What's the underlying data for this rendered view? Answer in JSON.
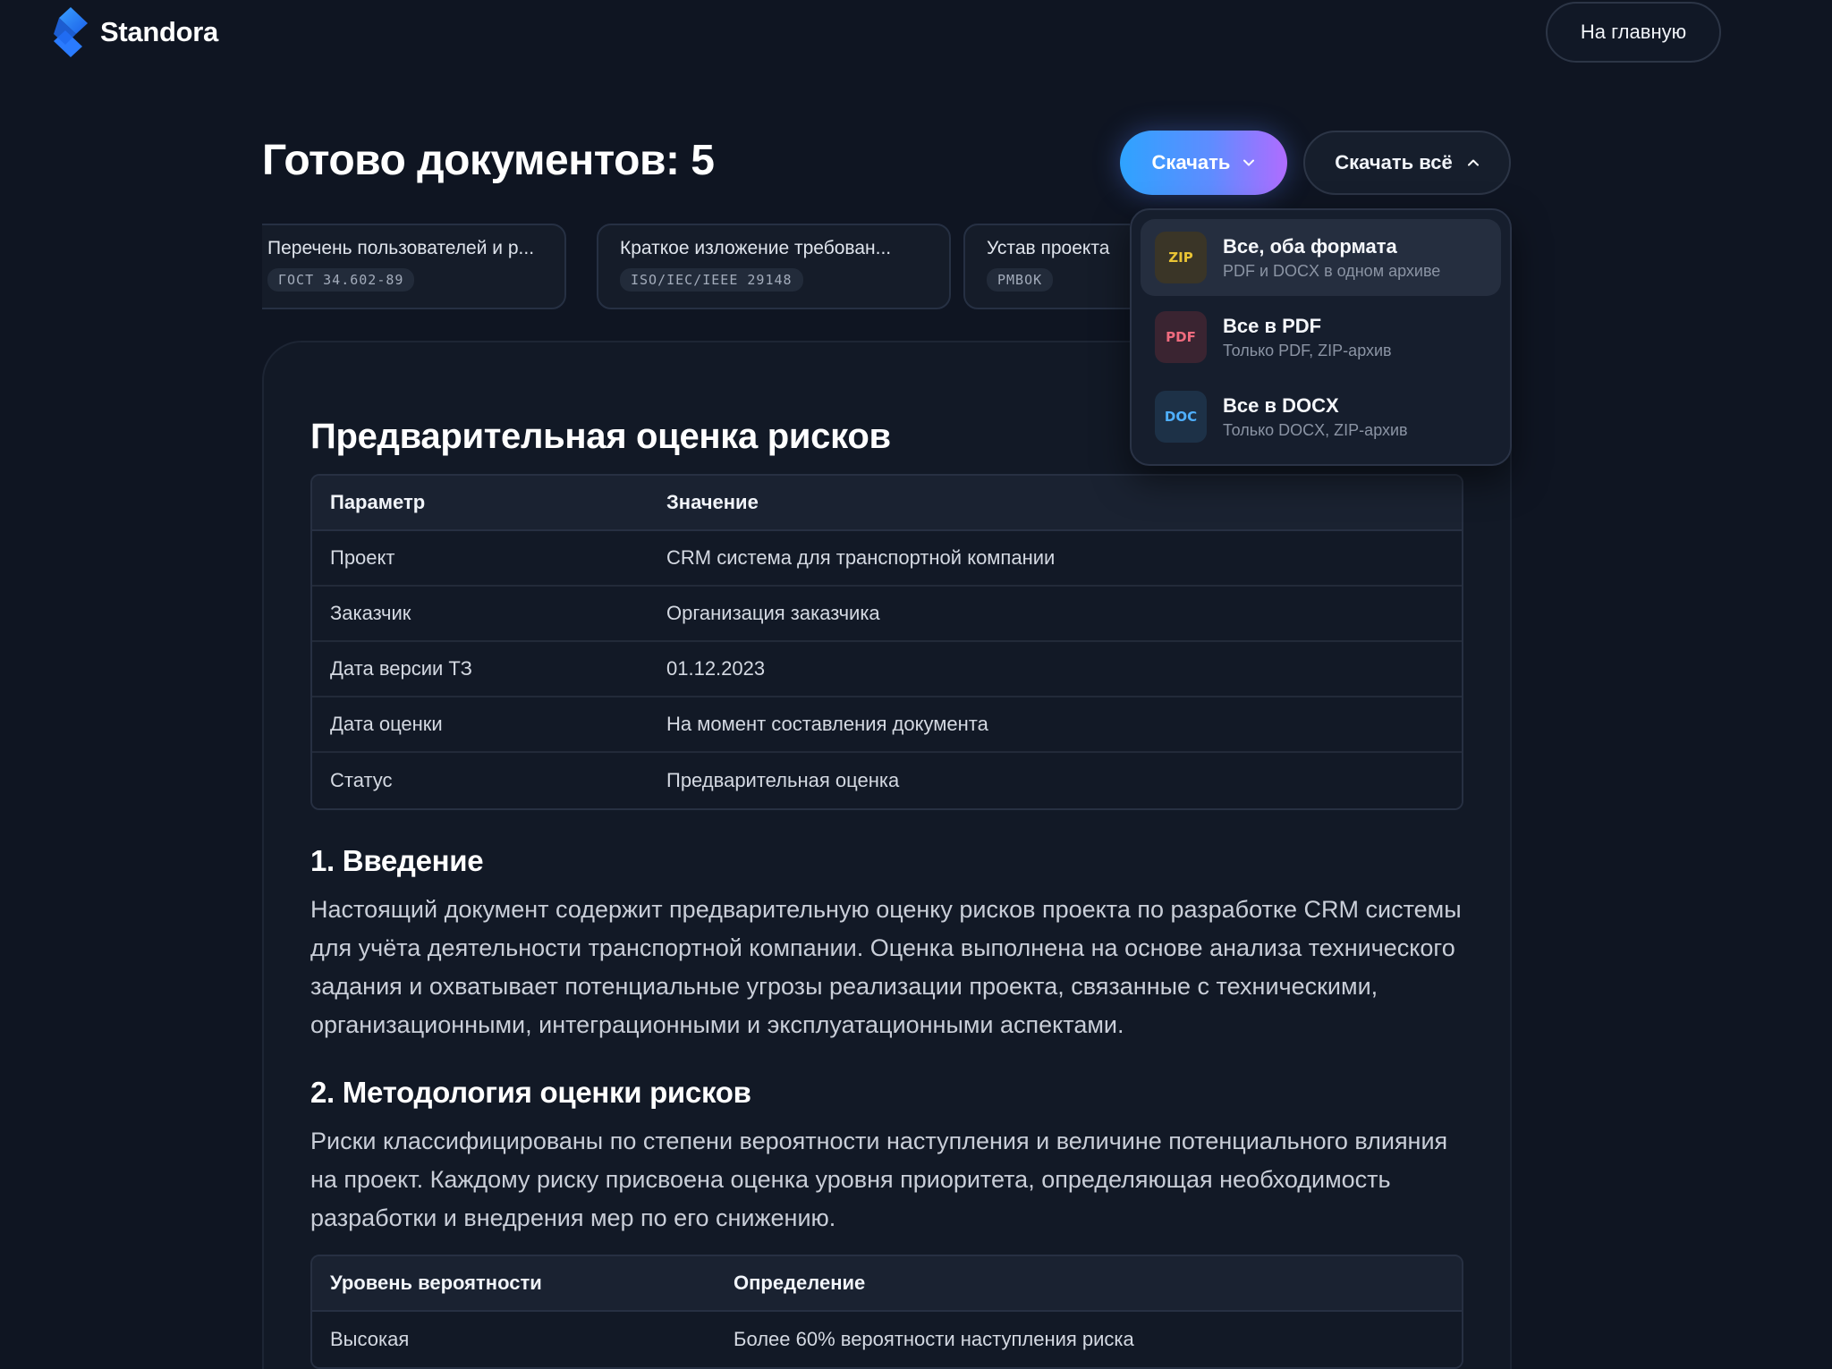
{
  "brand": {
    "name": "Standora"
  },
  "header": {
    "home_label": "На главную"
  },
  "page": {
    "title": "Готово документов: 5"
  },
  "actions": {
    "download_label": "Скачать",
    "download_all_label": "Скачать всё"
  },
  "doc_tabs": [
    {
      "title": "Перечень пользователей и р...",
      "badge": "ГОСТ 34.602-89"
    },
    {
      "title": "Краткое изложение требован...",
      "badge": "ISO/IEC/IEEE 29148"
    },
    {
      "title": "Устав проекта",
      "badge": "PMBOK"
    }
  ],
  "download_menu": [
    {
      "icon": "ZIP",
      "title": "Все, оба формата",
      "subtitle": "PDF и DOCX в одном архиве"
    },
    {
      "icon": "PDF",
      "title": "Все в PDF",
      "subtitle": "Только PDF, ZIP-архив"
    },
    {
      "icon": "DOC",
      "title": "Все в DOCX",
      "subtitle": "Только DOCX, ZIP-архив"
    }
  ],
  "document": {
    "title": "Предварительная оценка рисков",
    "summary_table": {
      "headers": [
        "Параметр",
        "Значение"
      ],
      "rows": [
        [
          "Проект",
          "CRM система для транспортной компании"
        ],
        [
          "Заказчик",
          "Организация заказчика"
        ],
        [
          "Дата версии ТЗ",
          "01.12.2023"
        ],
        [
          "Дата оценки",
          "На момент составления документа"
        ],
        [
          "Статус",
          "Предварительная оценка"
        ]
      ]
    },
    "sections": [
      {
        "heading": "1. Введение",
        "text": "Настоящий документ содержит предварительную оценку рисков проекта по разработке CRM системы для учёта деятельности транспортной компании. Оценка выполнена на основе анализа технического задания и охватывает потенциальные угрозы реализации проекта, связанные с техническими, организационными, интеграционными и эксплуатационными аспектами."
      },
      {
        "heading": "2. Методология оценки рисков",
        "text": "Риски классифицированы по степени вероятности наступления и величине потенциального влияния на проект. Каждому риску присвоена оценка уровня приоритета, определяющая необходимость разработки и внедрения мер по его снижению."
      }
    ],
    "probability_table": {
      "headers": [
        "Уровень вероятности",
        "Определение"
      ],
      "rows": [
        [
          "Высокая",
          "Более 60% вероятности наступления риска"
        ]
      ]
    }
  }
}
